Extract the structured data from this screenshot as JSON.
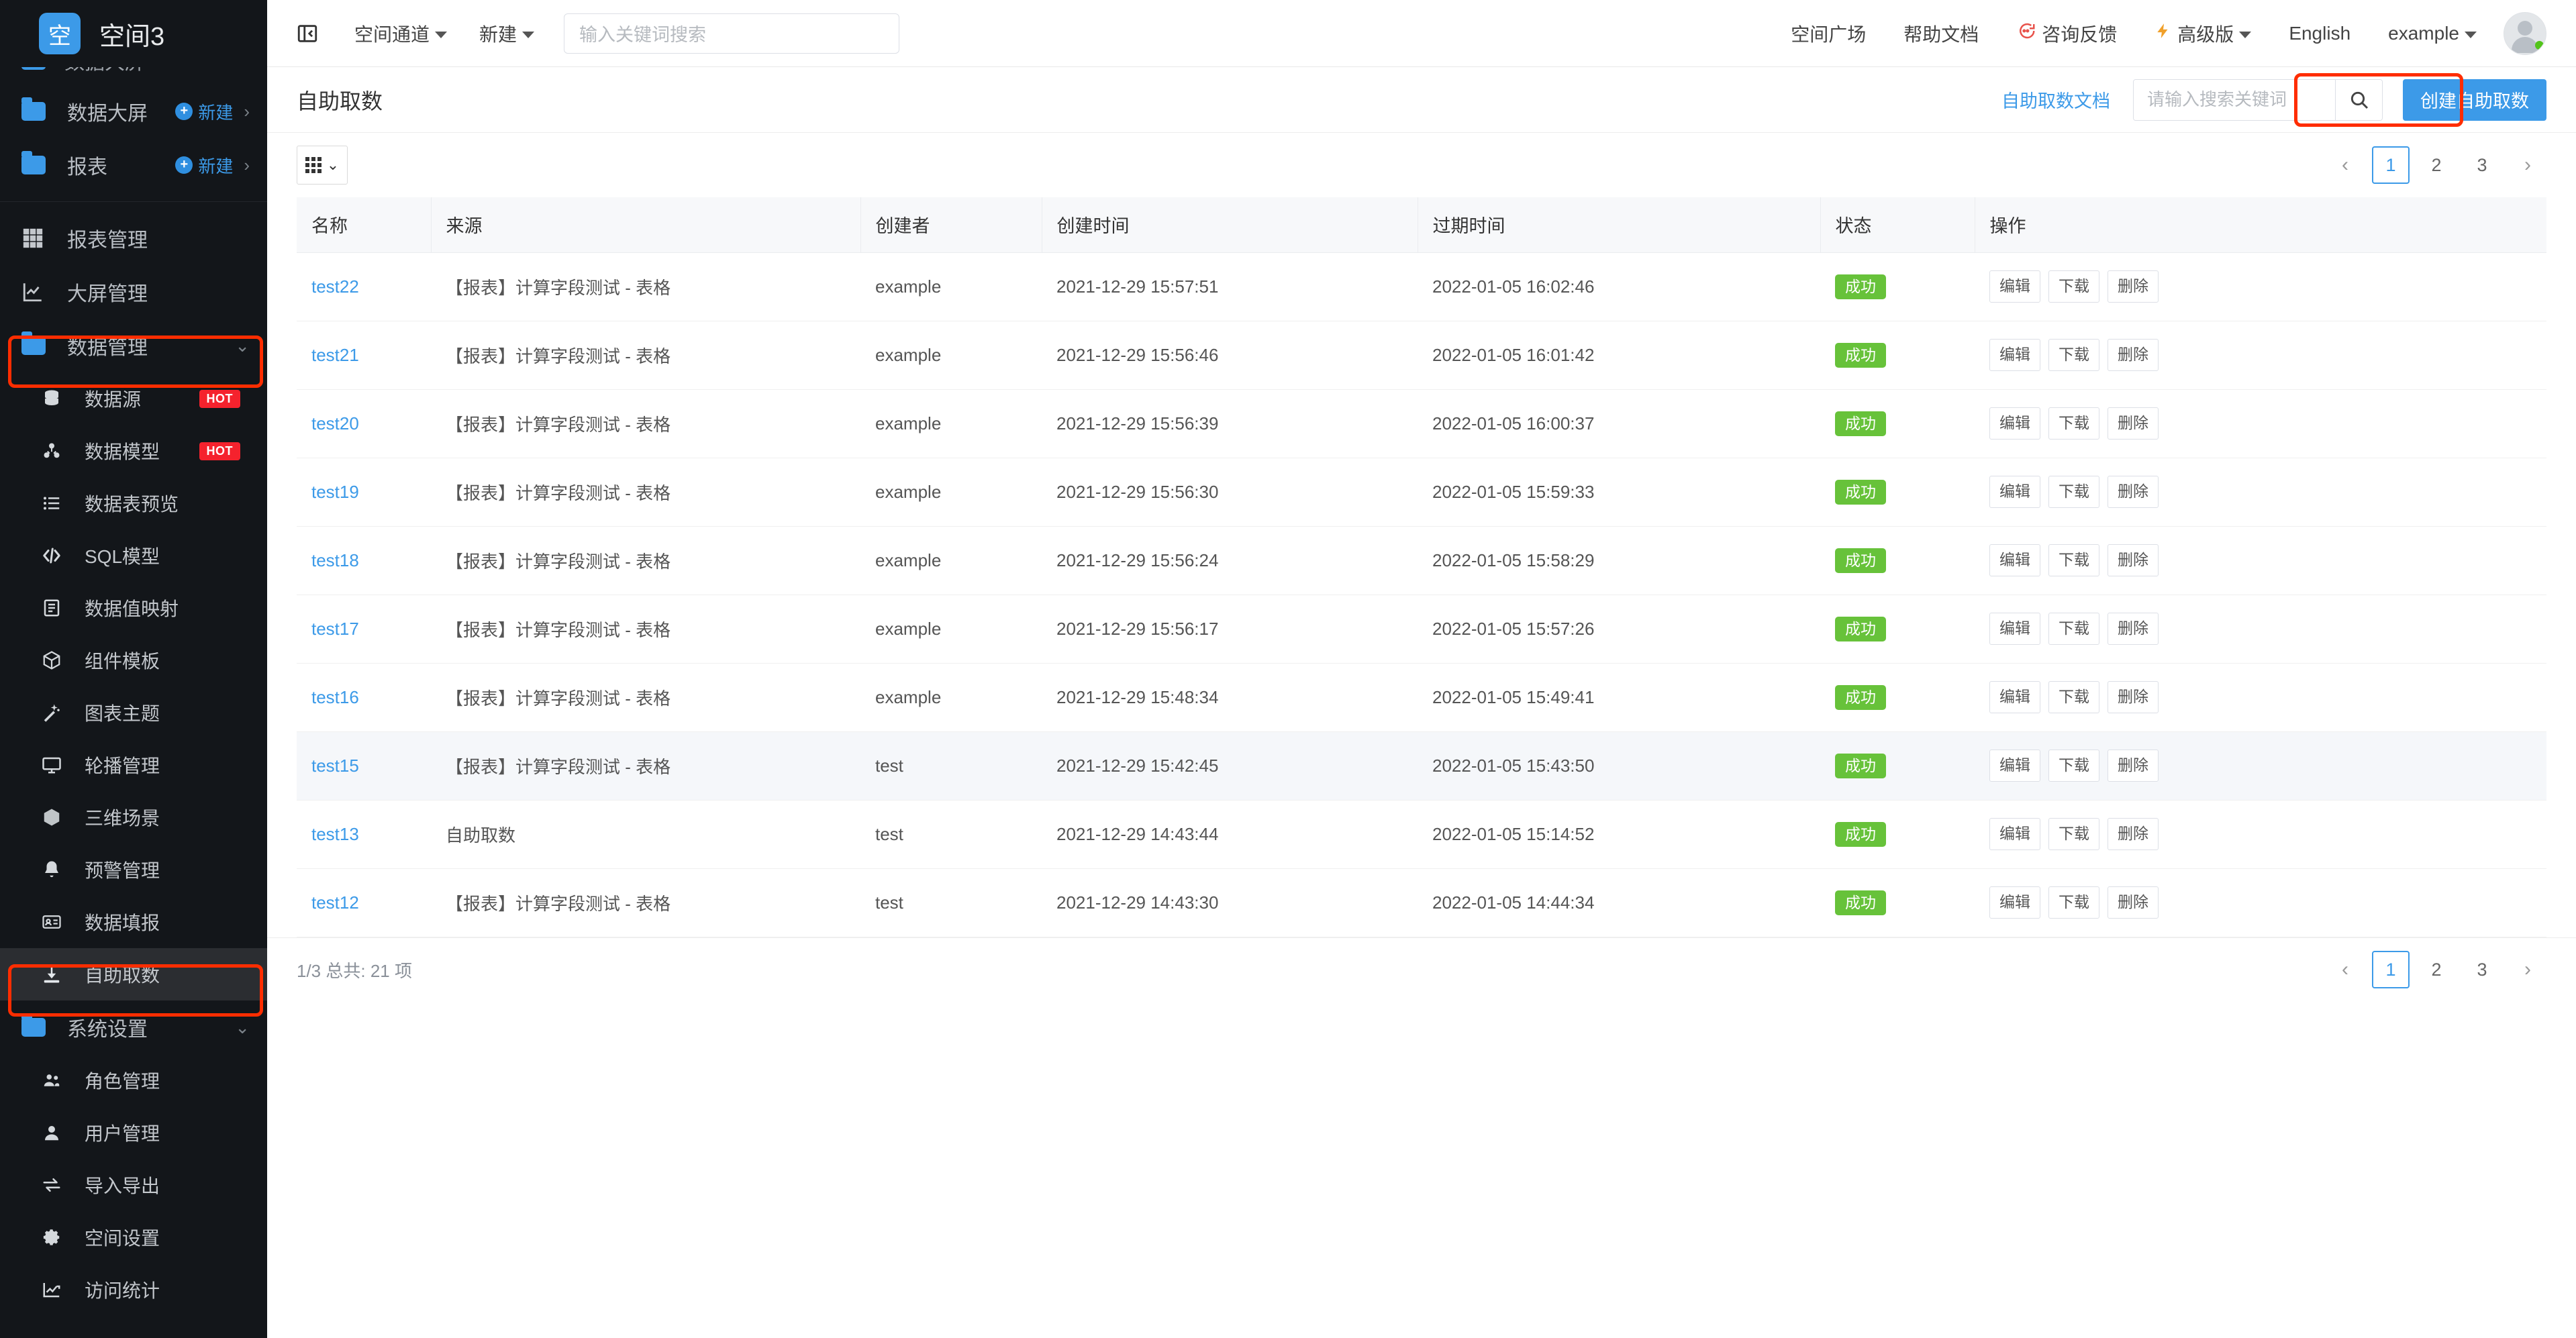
{
  "brand": {
    "logo_char": "空",
    "name": "空间3"
  },
  "sidebar": {
    "partial_item_label": "数据大屏",
    "folders": [
      {
        "label": "数据大屏",
        "new_label": "新建",
        "icon": "folder-icon"
      },
      {
        "label": "报表",
        "new_label": "新建",
        "icon": "folder-icon"
      }
    ],
    "nav": [
      {
        "label": "报表管理",
        "icon": "grid-icon"
      },
      {
        "label": "大屏管理",
        "icon": "chart-line-icon"
      }
    ],
    "group_data": {
      "label": "数据管理",
      "icon": "folder-icon",
      "expanded": true
    },
    "data_items": [
      {
        "label": "数据源",
        "icon": "database-icon",
        "badge": "HOT"
      },
      {
        "label": "数据模型",
        "icon": "model-icon",
        "badge": "HOT"
      },
      {
        "label": "数据表预览",
        "icon": "list-icon",
        "badge": ""
      },
      {
        "label": "SQL模型",
        "icon": "code-icon",
        "badge": ""
      },
      {
        "label": "数据值映射",
        "icon": "book-icon",
        "badge": ""
      },
      {
        "label": "组件模板",
        "icon": "cube-outline-icon",
        "badge": ""
      },
      {
        "label": "图表主题",
        "icon": "magic-wand-icon",
        "badge": ""
      },
      {
        "label": "轮播管理",
        "icon": "monitor-icon",
        "badge": ""
      },
      {
        "label": "三维场景",
        "icon": "cube-icon",
        "badge": ""
      },
      {
        "label": "预警管理",
        "icon": "bell-icon",
        "badge": ""
      },
      {
        "label": "数据填报",
        "icon": "id-card-icon",
        "badge": ""
      },
      {
        "label": "自助取数",
        "icon": "download-icon",
        "badge": "",
        "active": true
      }
    ],
    "group_settings": {
      "label": "系统设置",
      "icon": "folder-icon",
      "expanded": true
    },
    "settings_items": [
      {
        "label": "角色管理",
        "icon": "users-icon"
      },
      {
        "label": "用户管理",
        "icon": "user-icon"
      },
      {
        "label": "导入导出",
        "icon": "exchange-icon"
      },
      {
        "label": "空间设置",
        "icon": "gear-icon"
      },
      {
        "label": "访问统计",
        "icon": "analytics-icon"
      }
    ]
  },
  "topbar": {
    "collapse_icon": "collapse-sidebar-icon",
    "channel_label": "空间通道",
    "new_label": "新建",
    "search_placeholder": "输入关键词搜索",
    "search_value": "",
    "right_links": [
      "空间广场",
      "帮助文档",
      "咨询反馈",
      "高级版",
      "English",
      "example"
    ],
    "feedback_label": "咨询反馈",
    "pro_label": "高级版",
    "lang_label": "English",
    "user_label": "example"
  },
  "page": {
    "title": "自助取数",
    "doc_link": "自助取数文档",
    "search_placeholder": "请输入搜索关键词",
    "search_value": "",
    "create_button": "创建自助取数",
    "search_icon": "search-icon"
  },
  "toolbar": {
    "view_icon": "grid-view-icon",
    "chevron": "chevron-down-icon"
  },
  "pagination": {
    "prev": "‹",
    "next": "›",
    "pages": [
      "1",
      "2",
      "3"
    ],
    "current": "1"
  },
  "table": {
    "columns": [
      "名称",
      "来源",
      "创建者",
      "创建时间",
      "过期时间",
      "状态",
      "操作"
    ],
    "ops": [
      "编辑",
      "下载",
      "删除"
    ],
    "rows": [
      {
        "name": "test22",
        "source": "【报表】计算字段测试 - 表格",
        "creator": "example",
        "created": "2021-12-29 15:57:51",
        "expires": "2022-01-05 16:02:46",
        "status": "成功",
        "hover": false
      },
      {
        "name": "test21",
        "source": "【报表】计算字段测试 - 表格",
        "creator": "example",
        "created": "2021-12-29 15:56:46",
        "expires": "2022-01-05 16:01:42",
        "status": "成功",
        "hover": false
      },
      {
        "name": "test20",
        "source": "【报表】计算字段测试 - 表格",
        "creator": "example",
        "created": "2021-12-29 15:56:39",
        "expires": "2022-01-05 16:00:37",
        "status": "成功",
        "hover": false
      },
      {
        "name": "test19",
        "source": "【报表】计算字段测试 - 表格",
        "creator": "example",
        "created": "2021-12-29 15:56:30",
        "expires": "2022-01-05 15:59:33",
        "status": "成功",
        "hover": false
      },
      {
        "name": "test18",
        "source": "【报表】计算字段测试 - 表格",
        "creator": "example",
        "created": "2021-12-29 15:56:24",
        "expires": "2022-01-05 15:58:29",
        "status": "成功",
        "hover": false
      },
      {
        "name": "test17",
        "source": "【报表】计算字段测试 - 表格",
        "creator": "example",
        "created": "2021-12-29 15:56:17",
        "expires": "2022-01-05 15:57:26",
        "status": "成功",
        "hover": false
      },
      {
        "name": "test16",
        "source": "【报表】计算字段测试 - 表格",
        "creator": "example",
        "created": "2021-12-29 15:48:34",
        "expires": "2022-01-05 15:49:41",
        "status": "成功",
        "hover": false
      },
      {
        "name": "test15",
        "source": "【报表】计算字段测试 - 表格",
        "creator": "test",
        "created": "2021-12-29 15:42:45",
        "expires": "2022-01-05 15:43:50",
        "status": "成功",
        "hover": true
      },
      {
        "name": "test13",
        "source": "自助取数",
        "creator": "test",
        "created": "2021-12-29 14:43:44",
        "expires": "2022-01-05 15:14:52",
        "status": "成功",
        "hover": false
      },
      {
        "name": "test12",
        "source": "【报表】计算字段测试 - 表格",
        "creator": "test",
        "created": "2021-12-29 14:43:30",
        "expires": "2022-01-05 14:44:34",
        "status": "成功",
        "hover": false
      }
    ]
  },
  "footer": {
    "total_text": "1/3 总共: 21 项"
  },
  "colors": {
    "accent": "#3c9ae8",
    "success": "#67c23a",
    "hot": "#f5222d",
    "highlight": "#ff2d00"
  }
}
